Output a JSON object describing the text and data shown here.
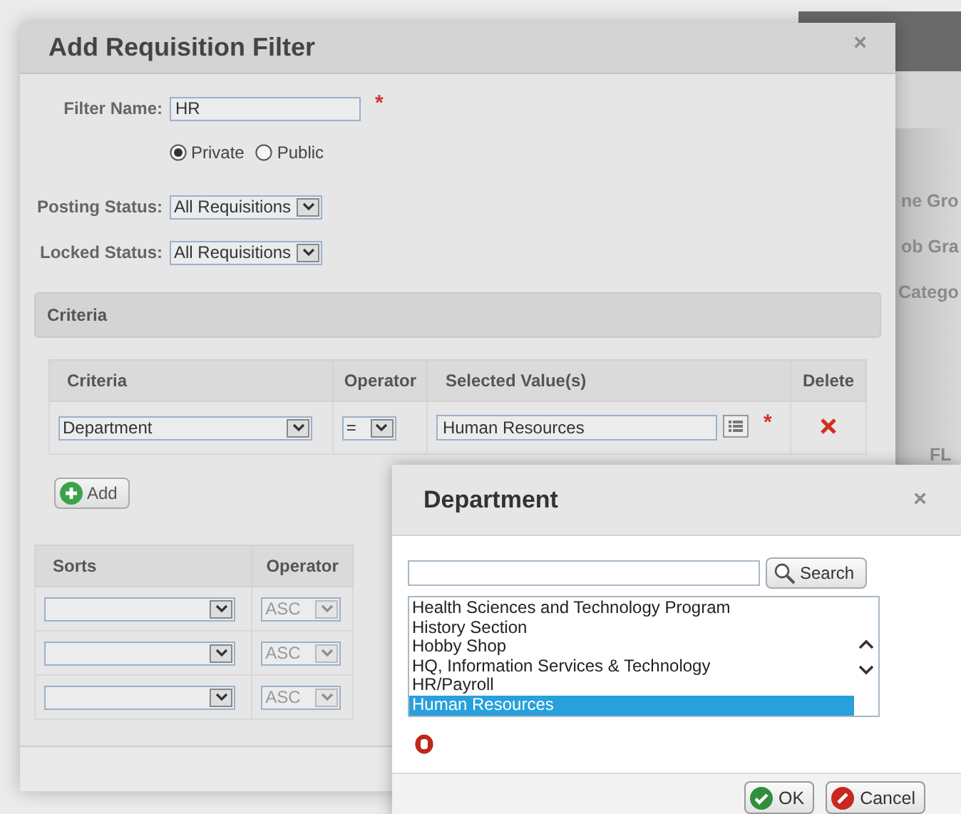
{
  "background_page": {
    "labels": [
      "ne Gro",
      "ob Gra",
      "Catego",
      "FL"
    ]
  },
  "filter_dialog": {
    "title": "Add Requisition Filter",
    "close": "×",
    "filter_name": {
      "label": "Filter Name:",
      "value": "HR",
      "required_mark": "*"
    },
    "visibility": [
      {
        "label": "Private",
        "selected": true
      },
      {
        "label": "Public",
        "selected": false
      }
    ],
    "posting_status": {
      "label": "Posting Status:",
      "value": "All Requisitions"
    },
    "locked_status": {
      "label": "Locked Status:",
      "value": "All Requisitions"
    },
    "criteria_section": {
      "title": "Criteria"
    },
    "criteria_table": {
      "columns": [
        "Criteria",
        "Operator",
        "Selected Value(s)",
        "Delete"
      ],
      "rows": [
        {
          "criteria": "Department",
          "operator": "=",
          "value": "Human Resources",
          "required_mark": "*"
        }
      ]
    },
    "add_button": "Add",
    "sorts_table": {
      "columns": [
        "Sorts",
        "Operator"
      ],
      "rows": [
        {
          "operator": "ASC",
          "disabled": true
        },
        {
          "operator": "ASC",
          "disabled": true
        },
        {
          "operator": "ASC",
          "disabled": true
        }
      ]
    }
  },
  "department_dialog": {
    "title": "Department",
    "close": "×",
    "search_button": "Search",
    "options": [
      {
        "label": "Health Sciences and Technology Program",
        "selected": false
      },
      {
        "label": "History Section",
        "selected": false
      },
      {
        "label": "Hobby Shop",
        "selected": false
      },
      {
        "label": "HQ, Information Services & Technology",
        "selected": false
      },
      {
        "label": "HR/Payroll",
        "selected": false
      },
      {
        "label": "Human Resources",
        "selected": true
      }
    ],
    "ok_button": "OK",
    "cancel_button": "Cancel"
  }
}
